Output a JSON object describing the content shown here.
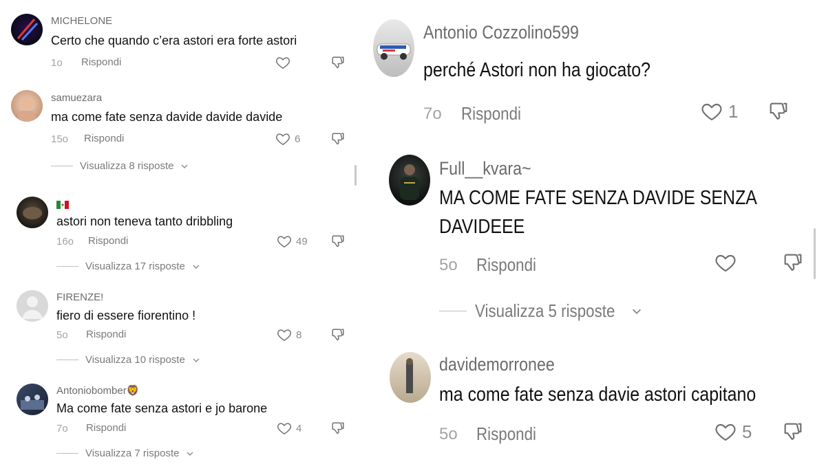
{
  "left": {
    "comments": [
      {
        "username": "MICHELONE",
        "text": "Certo che quando c’era astori era forte astori",
        "time": "1o",
        "reply": "Rispondi",
        "likes": ""
      },
      {
        "username": "samuezara",
        "text": "ma come fate senza davide davide davide",
        "time": "15o",
        "reply": "Rispondi",
        "likes": "6",
        "view": "Visualizza 8 risposte"
      },
      {
        "username": "",
        "text": "astori non teneva tanto dribbling",
        "time": "16o",
        "reply": "Rispondi",
        "likes": "49",
        "view": "Visualizza 17 risposte",
        "flag": "mexico-flag"
      },
      {
        "username": "FIRENZE!",
        "text": "fiero di essere fiorentino !",
        "time": "5o",
        "reply": "Rispondi",
        "likes": "8",
        "view": "Visualizza 10 risposte"
      },
      {
        "username": "Antoniobomber🦁",
        "text": "Ma come fate senza astori e jo barone",
        "time": "7o",
        "reply": "Rispondi",
        "likes": "4",
        "view": "Visualizza 7 risposte"
      }
    ]
  },
  "right": {
    "comments": [
      {
        "username": "Antonio Cozzolino599",
        "text": "perché Astori non ha giocato?",
        "time": "7o",
        "reply": "Rispondi",
        "likes": "1"
      },
      {
        "username": "Full__kvara~",
        "text_line1": "MA COME FATE SENZA DAVIDE SENZA",
        "text_line2": "DAVIDEEE",
        "time": "5o",
        "reply": "Rispondi",
        "likes": "",
        "view": "Visualizza 5 risposte"
      },
      {
        "username": "davidemorronee",
        "text": "ma come fate senza davie astori capitano",
        "time": "5o",
        "reply": "Rispondi",
        "likes": "5"
      }
    ]
  },
  "colors": {
    "username": "#6b6b6b",
    "meta": "#a3a3a3",
    "text": "#111111",
    "line": "#bdbdbd"
  },
  "icons": {
    "like": "heart-outline-icon",
    "dislike": "thumbs-down-icon",
    "chevron": "chevron-down-icon"
  }
}
